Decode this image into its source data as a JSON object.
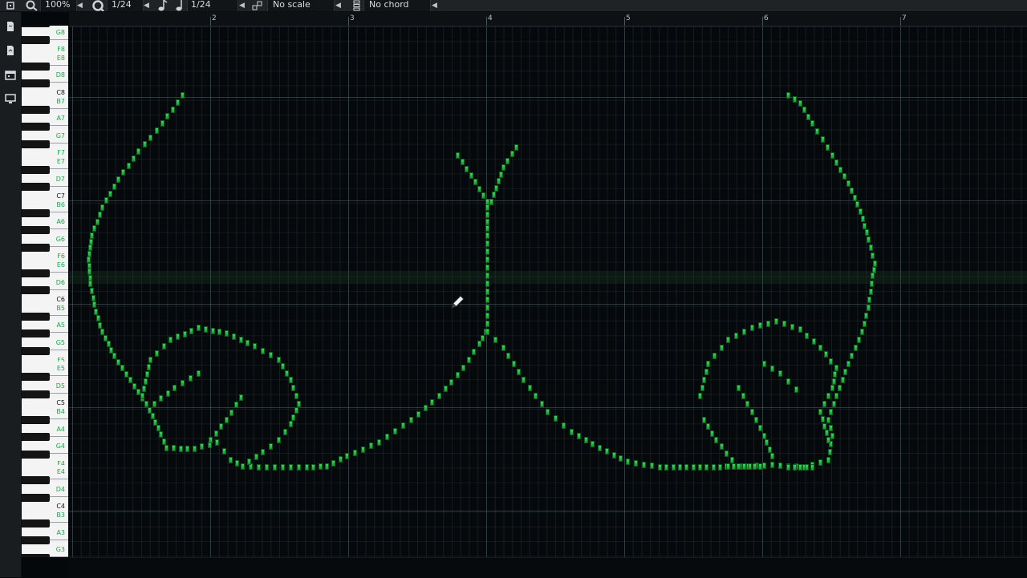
{
  "toolbar": {
    "zoom_label": "100%",
    "quantize_label": "1/24",
    "note_length_label": "1/24",
    "scale_label": "No scale",
    "chord_label": "No chord"
  },
  "ruler": {
    "bars": [
      "2",
      "3",
      "4",
      "5",
      "6",
      "7"
    ]
  },
  "keyboard": {
    "labels": [
      "G8",
      "F8",
      "E8",
      "D8",
      "C8",
      "B7",
      "A7",
      "G7",
      "F7",
      "E7",
      "D7",
      "C7",
      "B6",
      "A6",
      "G6",
      "F6",
      "E6",
      "D6",
      "C6",
      "B5",
      "A5",
      "G5",
      "F5",
      "E5",
      "D5",
      "C5",
      "B4",
      "A4",
      "G4",
      "F4",
      "E4",
      "D4",
      "C4",
      "B3",
      "A3",
      "G3"
    ]
  },
  "colors": {
    "note_fill": "#2fc24c",
    "background": "#05080a",
    "key_label": "#1aa84a"
  },
  "icons": {
    "cursor": "pencil-icon"
  }
}
